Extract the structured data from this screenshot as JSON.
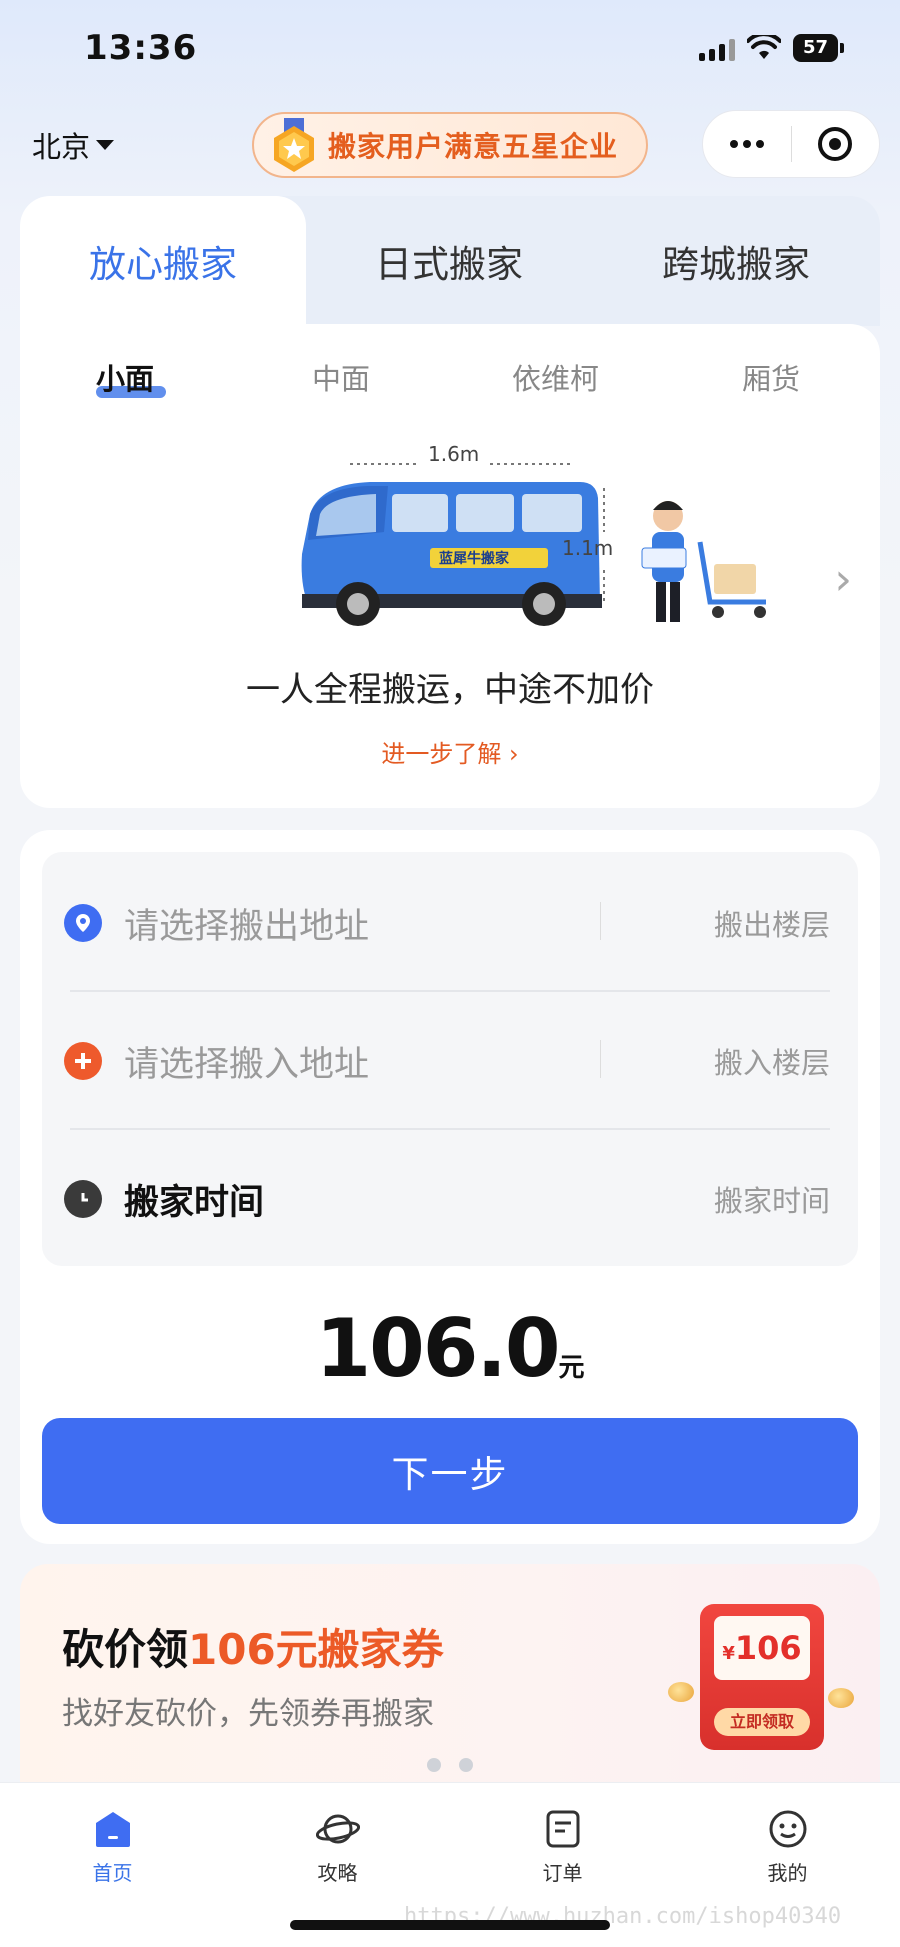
{
  "status_bar": {
    "time": "13:36",
    "battery": "57"
  },
  "header": {
    "city": "北京",
    "badge_text": "搬家用户满意五星企业"
  },
  "service_tabs": [
    {
      "label": "放心搬家",
      "active": true
    },
    {
      "label": "日式搬家",
      "active": false
    },
    {
      "label": "跨城搬家",
      "active": false
    }
  ],
  "vehicle_tabs": [
    {
      "label": "小面",
      "active": true
    },
    {
      "label": "中面",
      "active": false
    },
    {
      "label": "依维柯",
      "active": false
    },
    {
      "label": "厢货",
      "active": false
    }
  ],
  "vehicle": {
    "width_label": "1.6m",
    "height_label": "1.1m",
    "brand": "蓝犀牛搬家",
    "slogan": "一人全程搬运，中途不加价",
    "learn_more": "进一步了解 ›"
  },
  "address_form": {
    "from_placeholder": "请选择搬出地址",
    "from_floor": "搬出楼层",
    "to_placeholder": "请选择搬入地址",
    "to_floor": "搬入楼层",
    "time_label": "搬家时间",
    "time_value": "搬家时间"
  },
  "price": {
    "amount": "106.0",
    "unit": "元"
  },
  "next_button": "下一步",
  "promo": {
    "title_prefix": "砍价领",
    "title_highlight": "106元搬家券",
    "subtitle": "找好友砍价，先领券再搬家",
    "coupon_amount": "106",
    "coupon_currency": "¥",
    "claim_button": "立即领取"
  },
  "tab_bar": [
    {
      "label": "首页",
      "icon": "home-icon",
      "active": true
    },
    {
      "label": "攻略",
      "icon": "planet-icon",
      "active": false
    },
    {
      "label": "订单",
      "icon": "order-icon",
      "active": false
    },
    {
      "label": "我的",
      "icon": "smile-icon",
      "active": false
    }
  ],
  "watermark": "https://www.huzhan.com/ishop40340",
  "colors": {
    "accent": "#3f6df2",
    "orange": "#ec5a27",
    "text": "#111111"
  }
}
